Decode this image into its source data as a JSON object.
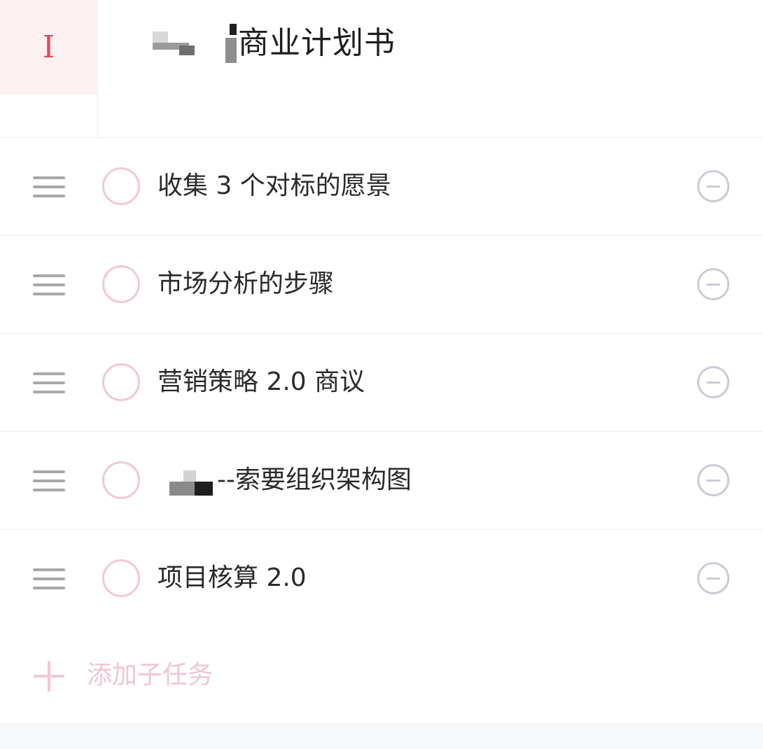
{
  "header": {
    "priority_glyph": "I",
    "title": "商业计划书"
  },
  "subtasks": [
    {
      "text": "收集 3 个对标的愿景"
    },
    {
      "text": "市场分析的步骤"
    },
    {
      "text": "营销策略 2.0 商议"
    },
    {
      "text": "--索要组织架构图"
    },
    {
      "text": "项目核算 2.0"
    }
  ],
  "add_subtask": {
    "label": "添加子任务"
  },
  "colors": {
    "priority": "#e04a5a",
    "checkbox": "#f1c8d3",
    "add_label": "#f0c6d2",
    "remove": "#c9ccd6"
  }
}
